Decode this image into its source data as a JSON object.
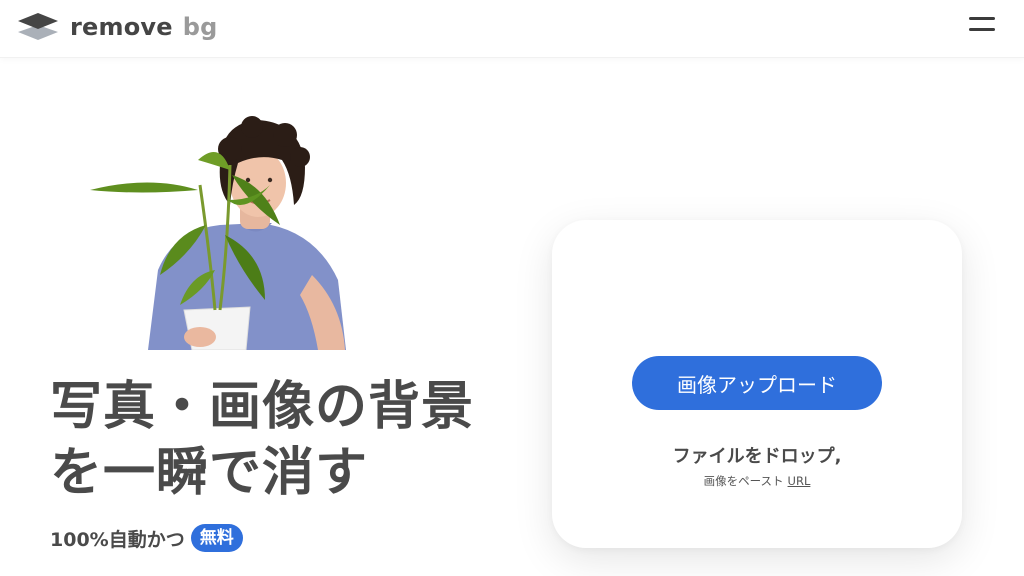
{
  "brand": {
    "name_part1": "remove",
    "name_part2": "bg",
    "colors": {
      "primary_blue": "#2f6fdc",
      "text_dark": "#454545",
      "text_muted": "#9a9a9a"
    }
  },
  "header": {
    "menu_icon": "hamburger-menu-icon"
  },
  "hero": {
    "image": "person-holding-plant-photo",
    "headline_line1": "写真・画像の背景",
    "headline_line2": "を一瞬で消す",
    "subline_text": "100%自動かつ",
    "free_badge": "無料"
  },
  "upload": {
    "button_label": "画像アップロード",
    "drop_text": "ファイルをドロップ,",
    "paste_text": "画像をペースト",
    "url_link": "URL"
  }
}
